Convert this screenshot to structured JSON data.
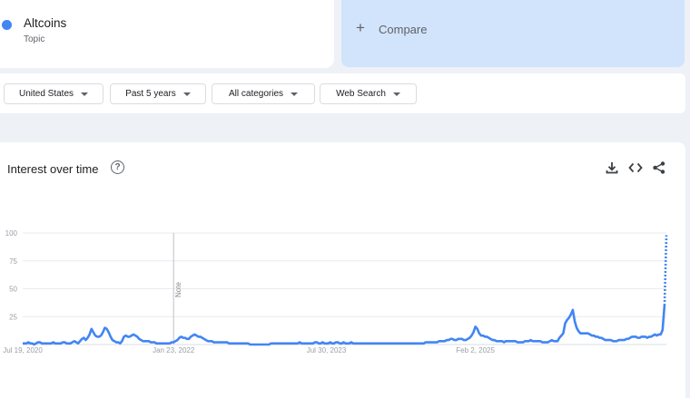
{
  "term": {
    "name": "Altcoins",
    "type": "Topic",
    "color": "#4285f4"
  },
  "compare": {
    "plus": "+",
    "label": "Compare"
  },
  "filters": [
    {
      "label": "United States"
    },
    {
      "label": "Past 5 years"
    },
    {
      "label": "All categories"
    },
    {
      "label": "Web Search"
    }
  ],
  "chart_section": {
    "title": "Interest over time",
    "help_symbol": "?"
  },
  "icons": {
    "help": "help-circle-icon",
    "download": "download-icon",
    "embed": "embed-code-icon",
    "share": "share-icon"
  },
  "chart_data": {
    "type": "line",
    "ylim": [
      0,
      100
    ],
    "y_ticks": [
      25,
      50,
      75,
      100
    ],
    "x_tick_labels": [
      {
        "label": "Jul 19, 2020",
        "x": 0
      },
      {
        "label": "Jan 23, 2022",
        "x": 79
      },
      {
        "label": "Jul 30, 2023",
        "x": 159
      },
      {
        "label": "Feb 2, 2025",
        "x": 237
      }
    ],
    "note": {
      "label": "Note",
      "x": 79
    },
    "series": [
      {
        "color": "#4285f4",
        "solid_values": [
          1,
          1,
          1,
          2,
          1,
          1,
          0,
          1,
          2,
          2,
          1,
          1,
          1,
          1,
          1,
          1,
          2,
          1,
          1,
          1,
          1,
          2,
          2,
          1,
          1,
          1,
          2,
          3,
          2,
          1,
          3,
          5,
          6,
          4,
          6,
          9,
          14,
          11,
          8,
          7,
          7,
          8,
          11,
          15,
          14,
          11,
          7,
          4,
          3,
          2,
          2,
          1,
          3,
          7,
          8,
          7,
          7,
          8,
          9,
          8,
          7,
          5,
          4,
          3,
          3,
          3,
          3,
          2,
          2,
          2,
          1,
          1,
          1,
          1,
          1,
          1,
          1,
          1,
          2,
          2,
          3,
          4,
          6,
          7,
          6,
          6,
          5,
          5,
          7,
          8,
          9,
          8,
          7,
          7,
          6,
          5,
          4,
          3,
          3,
          3,
          2,
          2,
          2,
          2,
          2,
          2,
          2,
          2,
          1,
          1,
          1,
          1,
          1,
          1,
          1,
          1,
          1,
          1,
          1,
          0,
          0,
          0,
          0,
          0,
          0,
          0,
          0,
          0,
          0,
          0,
          1,
          1,
          1,
          1,
          1,
          1,
          1,
          1,
          1,
          1,
          1,
          1,
          1,
          1,
          1,
          2,
          1,
          1,
          1,
          1,
          1,
          1,
          1,
          2,
          2,
          1,
          1,
          2,
          1,
          1,
          1,
          2,
          1,
          1,
          2,
          2,
          1,
          1,
          2,
          1,
          1,
          1,
          2,
          1,
          1,
          1,
          1,
          1,
          1,
          1,
          1,
          1,
          1,
          1,
          1,
          1,
          1,
          1,
          1,
          1,
          1,
          1,
          1,
          1,
          1,
          1,
          1,
          1,
          1,
          1,
          1,
          1,
          1,
          1,
          1,
          1,
          1,
          1,
          1,
          1,
          1,
          2,
          2,
          2,
          2,
          2,
          2,
          2,
          3,
          3,
          3,
          3,
          4,
          4,
          5,
          5,
          4,
          4,
          5,
          5,
          5,
          4,
          4,
          5,
          6,
          8,
          11,
          16,
          14,
          10,
          8,
          8,
          7,
          7,
          6,
          5,
          4,
          4,
          3,
          3,
          3,
          3,
          2,
          3,
          3,
          3,
          3,
          3,
          3,
          2,
          2,
          2,
          2,
          3,
          3,
          3,
          4,
          3,
          3,
          3,
          3,
          3,
          2,
          2,
          2,
          2,
          3,
          4,
          3,
          3,
          3,
          6,
          8,
          10,
          19,
          22,
          24,
          27,
          31,
          21,
          15,
          12,
          10,
          10,
          10,
          10,
          10,
          9,
          8,
          8,
          7,
          7,
          6,
          6,
          5,
          4,
          4,
          4,
          4,
          3,
          3,
          3,
          4,
          4,
          4,
          4,
          5,
          5,
          6,
          7,
          7,
          7,
          6,
          6,
          7,
          7,
          7,
          6,
          7,
          7,
          8,
          9,
          8,
          9,
          9,
          13,
          35
        ],
        "dotted_values": [
          35,
          98
        ]
      }
    ]
  }
}
